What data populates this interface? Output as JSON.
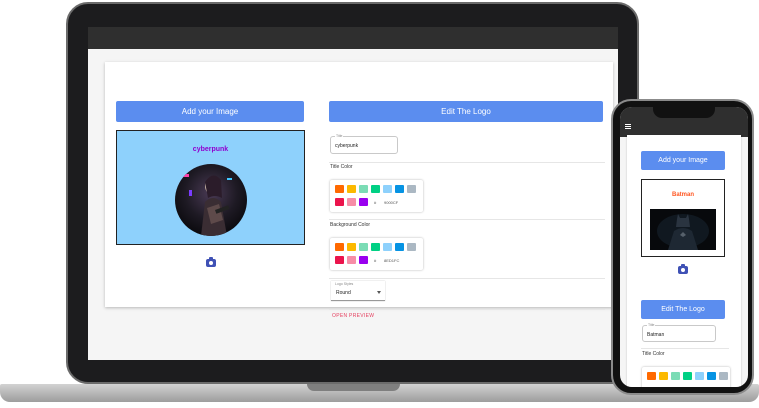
{
  "laptop": {
    "add_image_label": "Add your Image",
    "edit_logo_label": "Edit The Logo",
    "preview_title": "cyberpunk",
    "title_field": {
      "label": "Title",
      "value": "cyberpunk"
    },
    "title_color_label": "Title Color",
    "title_color_hex": "9000CF",
    "background_color_label": "Background Color",
    "background_color_hex": "8ED1FC",
    "logo_styles": {
      "label": "Logo Styles",
      "value": "Round"
    },
    "open_preview_label": "OPEN PREVIEW",
    "hash_symbol": "#"
  },
  "phone": {
    "add_image_label": "Add your Image",
    "edit_logo_label": "Edit The Logo",
    "preview_title": "Batman",
    "title_field": {
      "label": "Title",
      "value": "Batman"
    },
    "title_color_label": "Title Color"
  },
  "colors": {
    "swatches_row1": [
      "#ff6900",
      "#fcb900",
      "#7bdcb5",
      "#00d084",
      "#8ed1fc",
      "#0693e3",
      "#abb8c3"
    ],
    "swatches_row2": [
      "#eb144c",
      "#f78da7",
      "#9900ef"
    ],
    "preview_bg": "#8ed1fc",
    "title_color": "#9000cf",
    "batman_title": "#ff5722",
    "accent": "#5b8def"
  }
}
